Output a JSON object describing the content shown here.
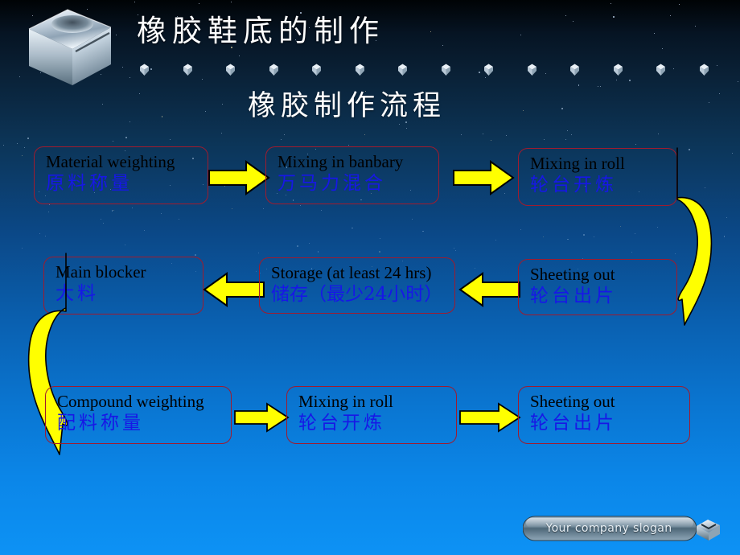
{
  "slide": {
    "title": "橡胶鞋底的制作",
    "subtitle": "橡胶制作流程",
    "background_top": "#000305",
    "background_bottom": "#0d92f5",
    "box_border_color": "#a01b2e",
    "english_text_color": "#000000",
    "chinese_text_color": "#1717e6",
    "arrow_color": "#ffff00",
    "logo_icon": "metallic-cube-logo"
  },
  "flow": {
    "rows": [
      {
        "row_index": 1,
        "boxes": [
          {
            "en": "Material weighting",
            "cn": "原料称量"
          },
          {
            "en": "Mixing in banbary",
            "cn": "万马力混合"
          },
          {
            "en": "Mixing in roll",
            "cn": "轮台开炼"
          }
        ],
        "arrows": [
          "arrow-right",
          "arrow-right"
        ]
      },
      {
        "row_index": 2,
        "boxes": [
          {
            "en": "Main blocker",
            "cn": "大料"
          },
          {
            "en": "Storage (at least 24 hrs)",
            "cn": "储存（最少24小时）"
          },
          {
            "en": "Sheeting out",
            "cn": "轮台出片"
          }
        ],
        "arrows": [
          "arrow-left",
          "arrow-left"
        ]
      },
      {
        "row_index": 3,
        "boxes": [
          {
            "en": "Compound weighting",
            "cn": "配料称量"
          },
          {
            "en": "Mixing in roll",
            "cn": "轮台开炼"
          },
          {
            "en": "Sheeting out",
            "cn": "轮台出片"
          }
        ],
        "arrows": [
          "arrow-right",
          "arrow-right"
        ]
      }
    ],
    "connectors": [
      {
        "name": "curved-arrow-right-down",
        "from": "Mixing in roll",
        "to": "Sheeting out"
      },
      {
        "name": "curved-arrow-left-down",
        "from": "Main blocker",
        "to": "Compound weighting"
      }
    ]
  },
  "footer": {
    "slogan": "Your company slogan",
    "icon": "cube-icon"
  }
}
